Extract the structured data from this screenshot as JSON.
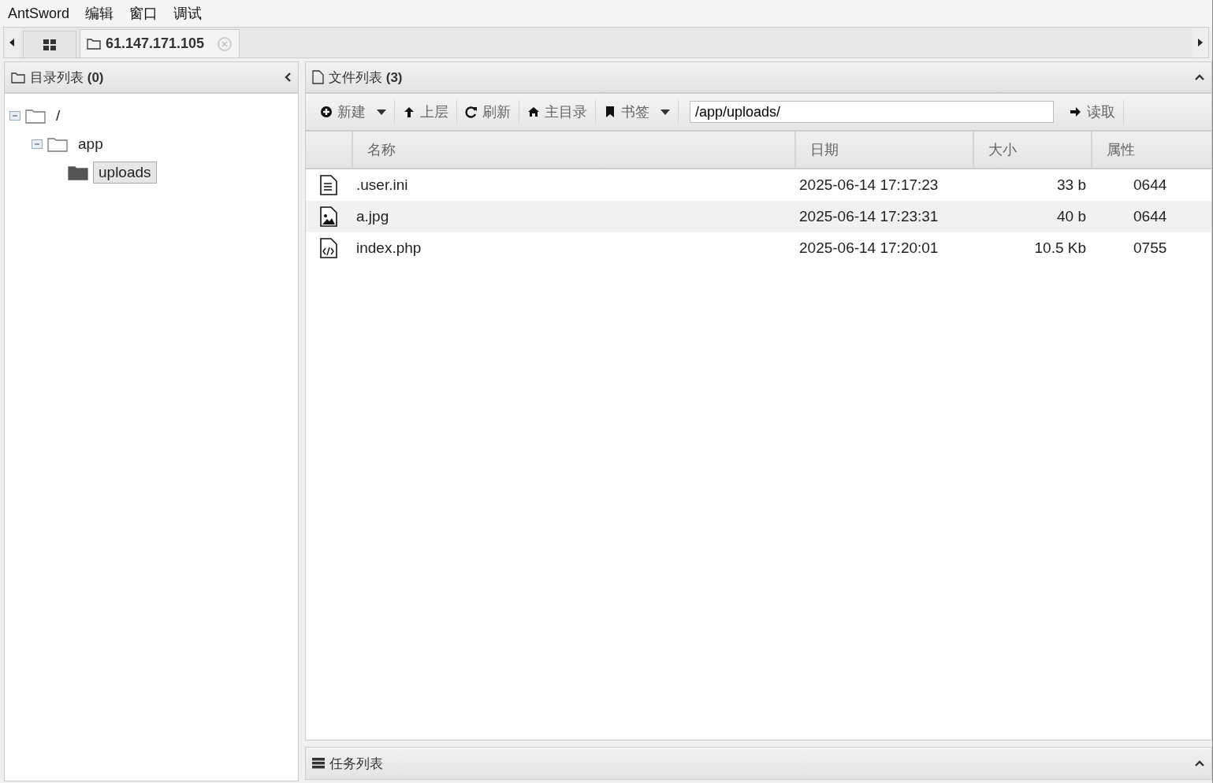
{
  "menu": [
    "AntSword",
    "编辑",
    "窗口",
    "调试"
  ],
  "tabs": [
    {
      "kind": "grid",
      "selected": false
    },
    {
      "kind": "folder",
      "label": "61.147.171.105",
      "selected": true
    }
  ],
  "dir_panel": {
    "title": "目录列表",
    "count": "(0)",
    "tree": [
      {
        "label": "/",
        "expanded": true,
        "selected": false,
        "children": [
          {
            "label": "app",
            "expanded": true,
            "selected": false,
            "children": [
              {
                "label": "uploads",
                "selected": true
              }
            ]
          }
        ]
      }
    ]
  },
  "file_panel": {
    "title": "文件列表",
    "count": "(3)",
    "toolbar": [
      {
        "kind": "new",
        "label": "新建",
        "dropdown": true
      },
      {
        "kind": "up",
        "label": "上层",
        "dropdown": false
      },
      {
        "kind": "refresh",
        "label": "刷新",
        "dropdown": false
      },
      {
        "kind": "home",
        "label": "主目录",
        "dropdown": false
      },
      {
        "kind": "bookmark",
        "label": "书签",
        "dropdown": true
      }
    ],
    "path": "/app/uploads/",
    "read_button": "读取",
    "columns": [
      "名称",
      "日期",
      "大小",
      "属性"
    ],
    "rows": [
      {
        "kind": "text",
        "name": ".user.ini",
        "date": "2025-06-14 17:17:23",
        "size": "33 b",
        "perm": "0644",
        "selected": false
      },
      {
        "kind": "image",
        "name": "a.jpg",
        "date": "2025-06-14 17:23:31",
        "size": "40 b",
        "perm": "0644",
        "selected": true
      },
      {
        "kind": "code",
        "name": "index.php",
        "date": "2025-06-14 17:20:01",
        "size": "10.5 Kb",
        "perm": "0755",
        "selected": false
      }
    ]
  },
  "task_panel": {
    "title": "任务列表"
  }
}
